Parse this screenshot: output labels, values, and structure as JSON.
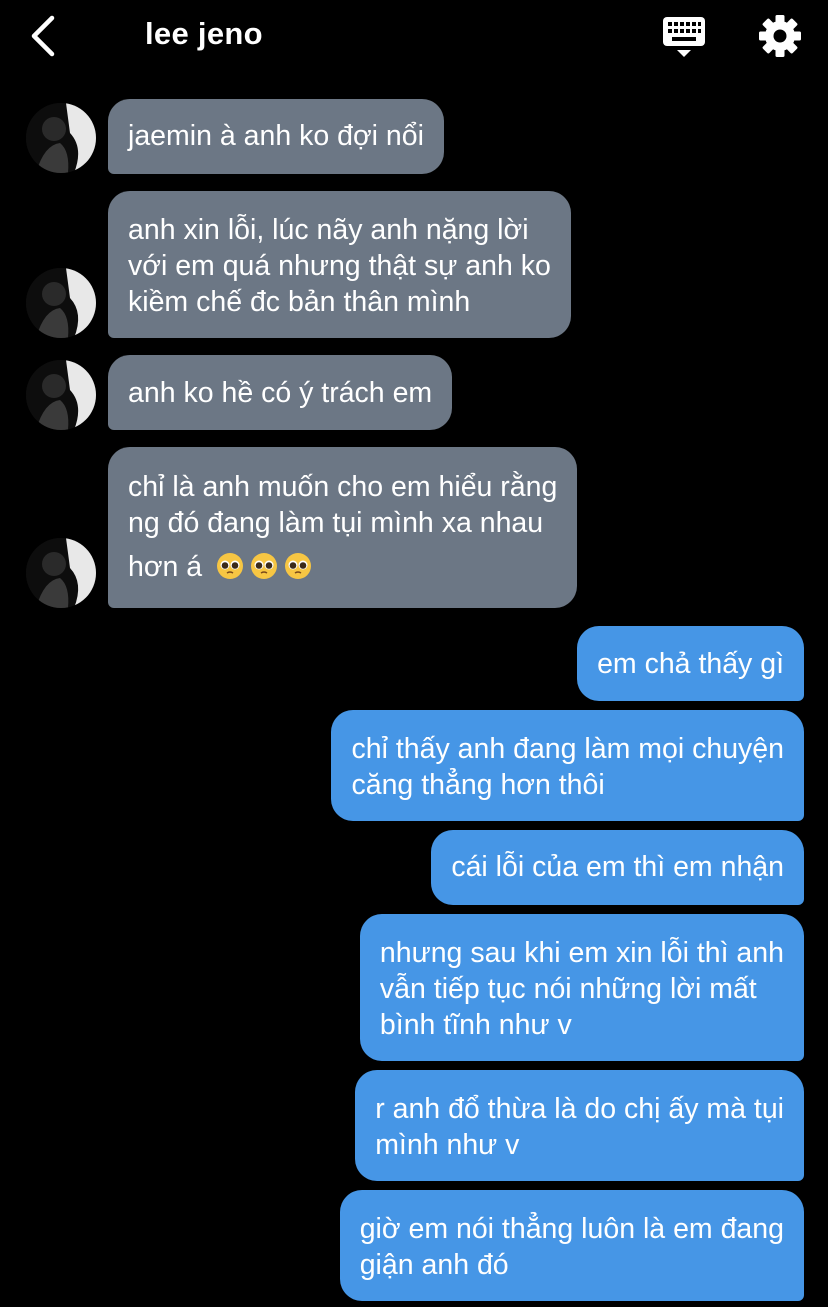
{
  "header": {
    "title": "lee jeno",
    "back_icon": "chevron-left-icon",
    "keyboard_icon": "keyboard-icon",
    "settings_icon": "gear-icon"
  },
  "colors": {
    "background": "#000000",
    "incoming_bubble": "#6c7785",
    "outgoing_bubble": "#4696e6"
  },
  "messages": [
    {
      "from": "lee jeno",
      "lines": [
        "jaemin à anh ko đợi nổi"
      ]
    },
    {
      "from": "lee jeno",
      "lines": [
        "anh xin lỗi, lúc nãy anh nặng lời",
        "với em quá nhưng thật sự anh ko",
        "kiềm chế đc bản thân mình"
      ]
    },
    {
      "from": "lee jeno",
      "lines": [
        "anh ko hề có ý trách em"
      ]
    },
    {
      "from": "lee jeno",
      "lines": [
        "chỉ là anh muốn cho em hiểu rằng",
        "ng đó đang làm tụi mình xa nhau",
        "hơn á"
      ],
      "emoji": "pleading-face x3"
    },
    {
      "from": "me",
      "lines": [
        "em chả thấy gì"
      ]
    },
    {
      "from": "me",
      "lines": [
        "chỉ thấy anh đang làm mọi chuyện",
        "căng thẳng hơn thôi"
      ]
    },
    {
      "from": "me",
      "lines": [
        "cái lỗi của em thì em nhận"
      ]
    },
    {
      "from": "me",
      "lines": [
        "nhưng sau khi em xin lỗi thì anh",
        "vẫn tiếp tục nói những lời mất",
        "bình tĩnh như v"
      ]
    },
    {
      "from": "me",
      "lines": [
        "r anh đổ thừa là do chị ấy mà tụi",
        "mình như v"
      ]
    },
    {
      "from": "me",
      "lines": [
        "giờ em nói thẳng luôn là em đang",
        "giận anh đó"
      ]
    }
  ]
}
